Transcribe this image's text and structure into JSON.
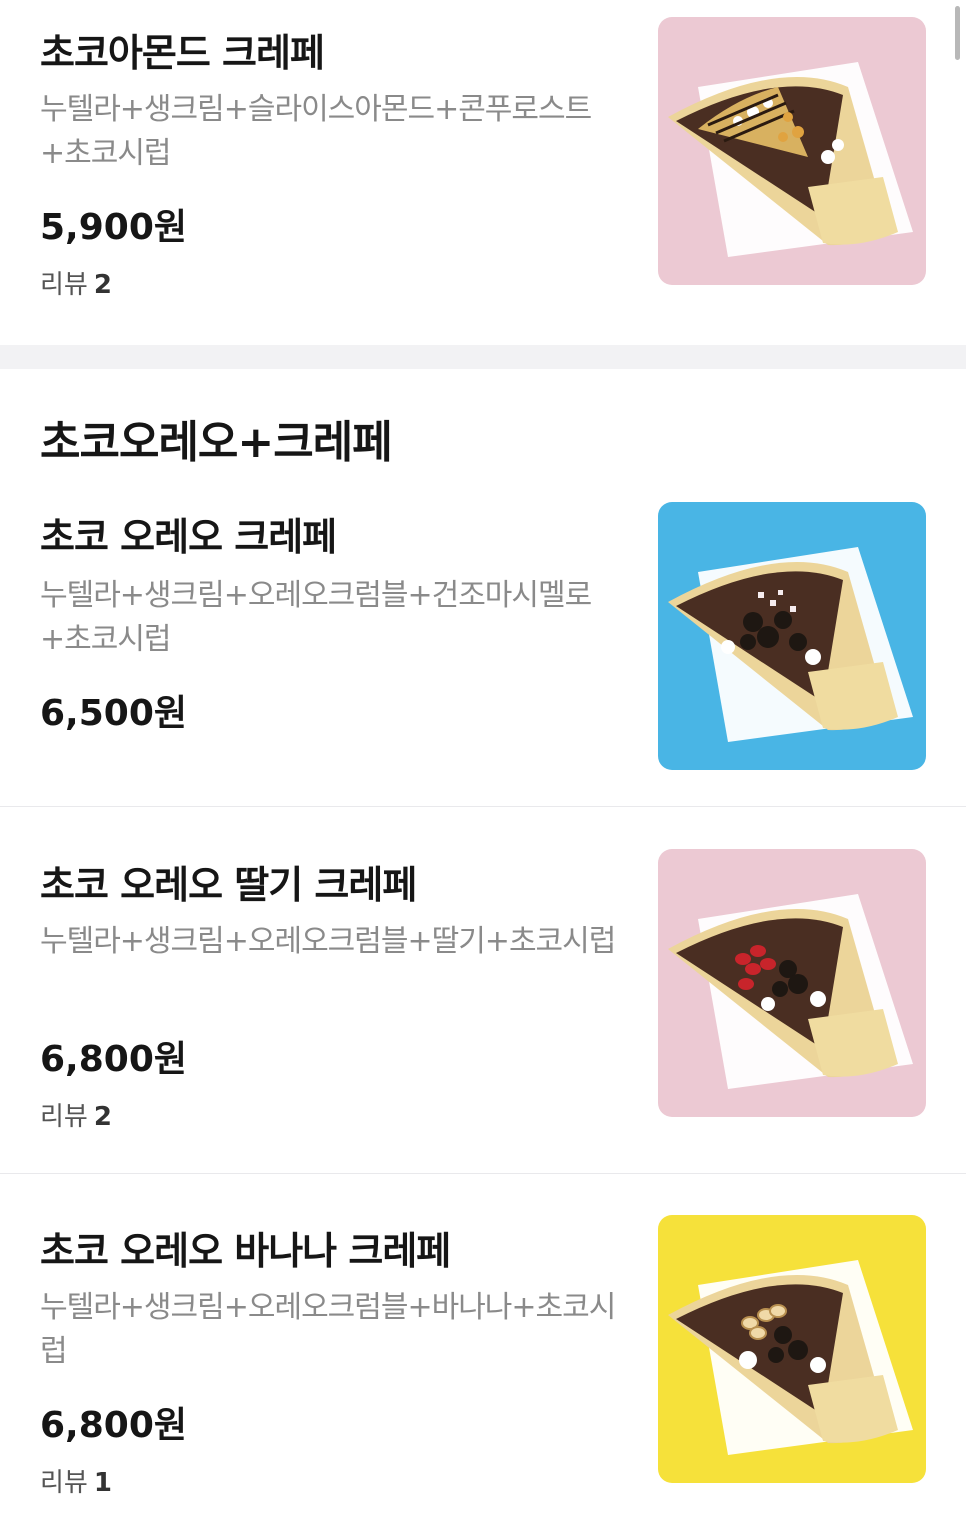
{
  "items": [
    {
      "name": "초코아몬드 크레페",
      "desc": "누텔라+생크림+슬라이스아몬드+콘푸로스트+초코시럽",
      "price": "5,900원",
      "review_label": "리뷰",
      "review_count": "2",
      "bg_color": "#ecc9d3",
      "topping": "almond"
    },
    {
      "name": "초코 오레오 크레페",
      "desc": "누텔라+생크림+오레오크럼블+건조마시멜로+초코시럽",
      "price": "6,500원",
      "bg_color": "#49b5e5",
      "topping": "oreo-marshmallow"
    },
    {
      "name": "초코 오레오 딸기 크레페",
      "desc": "누텔라+생크림+오레오크럼블+딸기+초코시럽",
      "price": "6,800원",
      "review_label": "리뷰",
      "review_count": "2",
      "bg_color": "#ecc9d3",
      "topping": "oreo-strawberry"
    },
    {
      "name": "초코 오레오 바나나 크레페",
      "desc": "누텔라+생크림+오레오크럼블+바나나+초코시럽",
      "price": "6,800원",
      "review_label": "리뷰",
      "review_count": "1",
      "bg_color": "#f6e13a",
      "topping": "oreo-banana"
    }
  ],
  "section": {
    "title": "초코오레오+크레페"
  }
}
